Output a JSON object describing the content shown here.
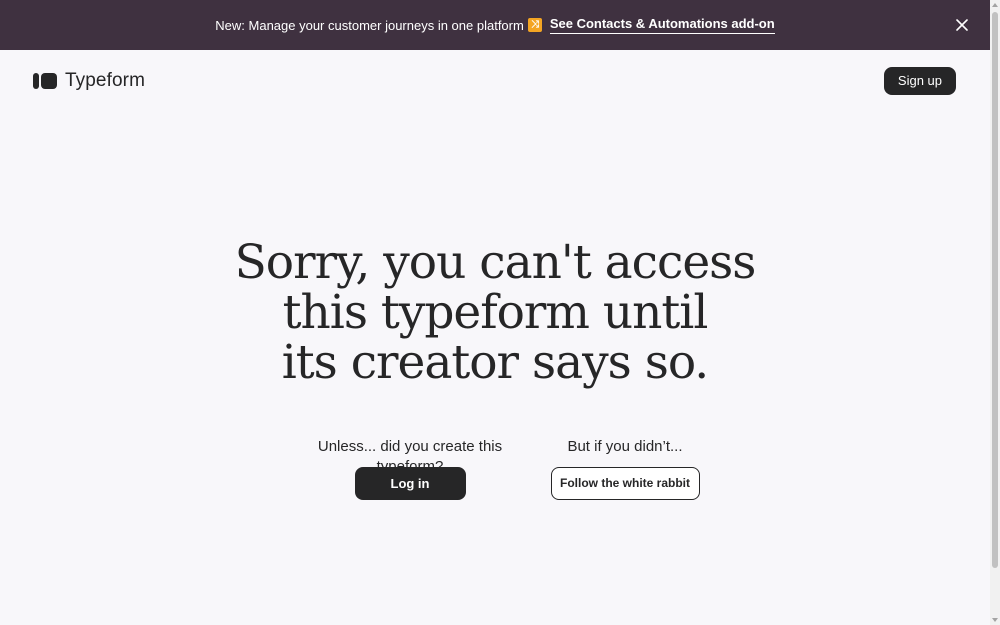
{
  "banner": {
    "text": "New: Manage your customer journeys in one platform",
    "emoji": "🔀",
    "link_label": "See Contacts & Automations add-on",
    "close_icon": "close-icon"
  },
  "header": {
    "logo_text": "Typeform",
    "signup_label": "Sign up"
  },
  "main": {
    "headline_lines": [
      "Sorry, you can't access",
      "this typeform until",
      "its creator says so."
    ],
    "left_prompt": "Unless... did you create this typeform?",
    "login_label": "Log in",
    "right_prompt": "But if you didn’t...",
    "rabbit_label": "Follow the white rabbit"
  },
  "colors": {
    "banner_bg": "#3f3140",
    "page_bg": "#f8f7fa",
    "primary": "#262627",
    "emoji_bg": "#f4a523"
  }
}
